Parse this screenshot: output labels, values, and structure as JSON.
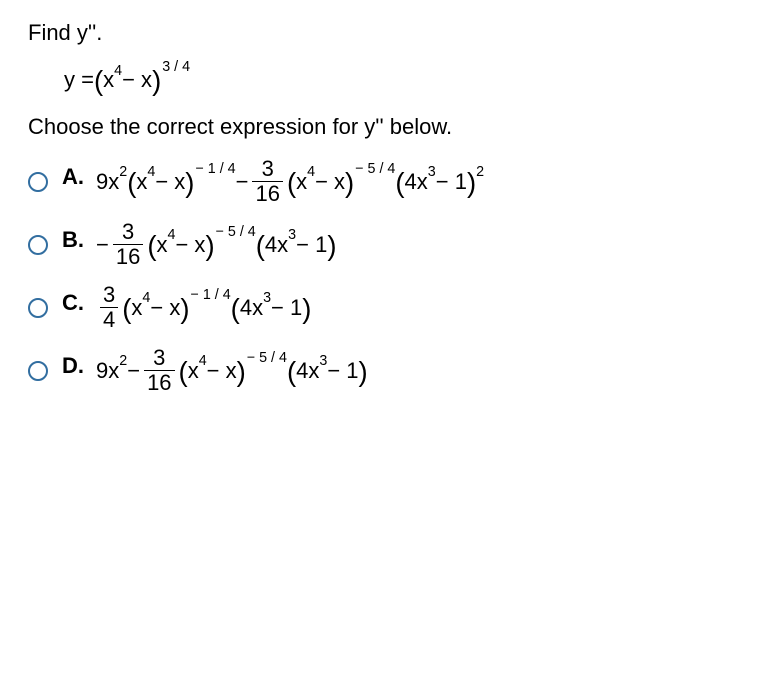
{
  "prompt": "Find y''.",
  "equation_html": "y = <span class='paren'>(</span>x<sup>4</sup> − x<span class='paren'>)</span><span class='sup-group'>3 / 4</span>",
  "instruction": "Choose the correct expression for y'' below.",
  "options": [
    {
      "letter": "A.",
      "html": "9x<sup>2</sup> <span class='paren'>(</span>x<sup>4</sup> − x<span class='paren'>)</span><span class='sup-group'> − 1 / 4</span> − <span class='frac'><span class='num'>3</span><span class='den'>16</span></span> <span class='paren'>(</span>x<sup>4</sup> − x<span class='paren'>)</span><span class='sup-group'> − 5 / 4</span> <span class='paren'>(</span>4x<sup>3</sup> − 1<span class='paren'>)</span><sup>2</sup>"
    },
    {
      "letter": "B.",
      "html": "− <span class='frac'><span class='num'>3</span><span class='den'>16</span></span> <span class='paren'>(</span>x<sup>4</sup> − x<span class='paren'>)</span><span class='sup-group'> − 5 / 4</span> <span class='paren'>(</span>4x<sup>3</sup> − 1<span class='paren'>)</span>"
    },
    {
      "letter": "C.",
      "html": "<span class='frac'><span class='num'>3</span><span class='den'>4</span></span> <span class='paren'>(</span>x<sup>4</sup> − x<span class='paren'>)</span><span class='sup-group'> − 1 / 4</span> <span class='paren'>(</span>4x<sup>3</sup> − 1<span class='paren'>)</span>"
    },
    {
      "letter": "D.",
      "html": "9x<sup>2</sup> − <span class='frac'><span class='num'>3</span><span class='den'>16</span></span> <span class='paren'>(</span>x<sup>4</sup> − x<span class='paren'>)</span><span class='sup-group'> − 5 / 4</span> <span class='paren'>(</span>4x<sup>3</sup> − 1<span class='paren'>)</span>"
    }
  ]
}
